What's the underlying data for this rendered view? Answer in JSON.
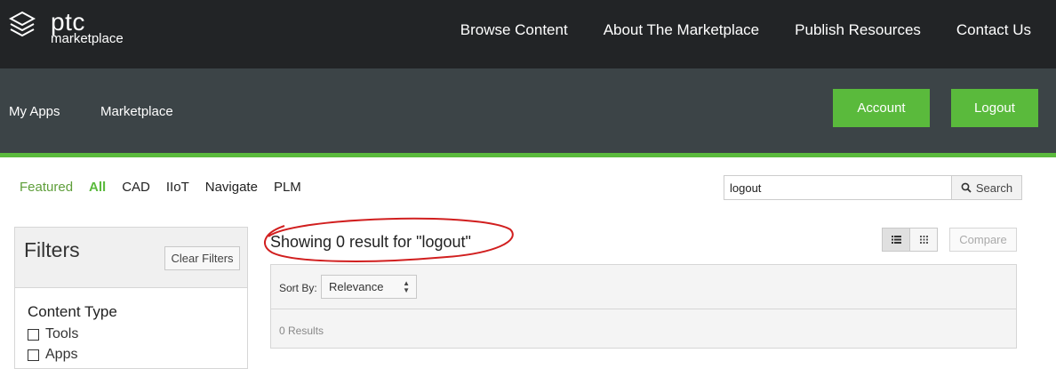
{
  "brand": {
    "name": "ptc",
    "subtitle": "marketplace"
  },
  "top_nav": [
    "Browse Content",
    "About The Marketplace",
    "Publish Resources",
    "Contact Us"
  ],
  "sub_nav": {
    "my_apps": "My Apps",
    "marketplace": "Marketplace",
    "account": "Account",
    "logout": "Logout"
  },
  "categories": {
    "featured": "Featured",
    "all": "All",
    "cad": "CAD",
    "iiot": "IIoT",
    "navigate": "Navigate",
    "plm": "PLM"
  },
  "search": {
    "value": "logout",
    "button": "Search"
  },
  "filters": {
    "title": "Filters",
    "clear": "Clear Filters",
    "content_type_title": "Content Type",
    "items": [
      "Tools",
      "Apps"
    ]
  },
  "results": {
    "heading": "Showing 0 result for \"logout\"",
    "compare": "Compare",
    "sort_label": "Sort By:",
    "sort_value": "Relevance",
    "count": "0 Results"
  },
  "colors": {
    "topbar": "#222426",
    "subbar": "#3c4447",
    "accent_green": "#5aba3c",
    "annotation_red": "#d11f1f"
  },
  "icons": {
    "logo": "ptc-logo-icon",
    "search": "search-icon",
    "list_view": "list-view-icon",
    "grid_view": "grid-view-icon",
    "sort": "sort-arrows-icon"
  }
}
